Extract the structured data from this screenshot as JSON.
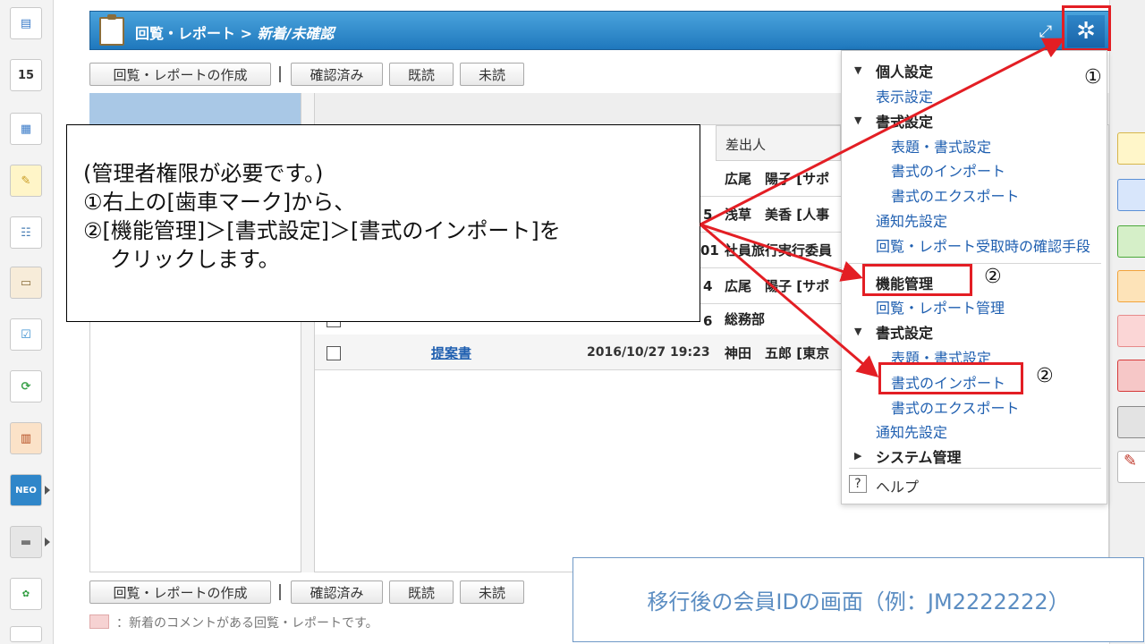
{
  "header": {
    "title": "回覧・レポート >",
    "subtitle": "新着/未確認"
  },
  "toolbar_top": {
    "create": "回覧・レポートの作成",
    "confirmed": "確認済み",
    "read": "既読",
    "unread": "未読"
  },
  "toolbar_bottom": {
    "create": "回覧・レポートの作成",
    "confirmed": "確認済み",
    "read": "既読",
    "unread": "未読"
  },
  "list": {
    "column_sender": "差出人",
    "rows": [
      {
        "time_suffix": "",
        "sender": "広尾　陽子 [サポ"
      },
      {
        "time_suffix": "5",
        "sender": "浅草　美香 [人事"
      },
      {
        "time_suffix": "01",
        "sender": "社員旅行実行委員"
      },
      {
        "time_suffix": "4",
        "sender": "広尾　陽子 [サポ"
      },
      {
        "time_suffix": "6",
        "sender": "総務部"
      },
      {
        "time_suffix": "",
        "title": "提案書",
        "date": "2016/10/27 19:23",
        "sender": "神田　五郎 [東京"
      }
    ]
  },
  "callout": {
    "line1": "(管理者権限が必要です。)",
    "line2": "①右上の[歯車マーク]から、",
    "line3": "②[機能管理]＞[書式設定]＞[書式のインポート]を",
    "line4": "クリックします。"
  },
  "dropdown": {
    "personal_settings": "個人設定",
    "display_settings": "表示設定",
    "format_settings_personal": "書式設定",
    "title_format_settings_1": "表題・書式設定",
    "format_import_1": "書式のインポート",
    "format_export_1": "書式のエクスポート",
    "notification_settings_1": "通知先設定",
    "confirm_method": "回覧・レポート受取時の確認手段",
    "function_management": "機能管理",
    "report_management": "回覧・レポート管理",
    "format_settings_admin": "書式設定",
    "title_format_settings_2": "表題・書式設定",
    "format_import_2": "書式のインポート",
    "format_export_2": "書式のエクスポート",
    "notification_settings_2": "通知先設定",
    "system_management": "システム管理",
    "help_icon": "?",
    "help": "ヘルプ"
  },
  "labels": {
    "step1": "①",
    "step2a": "②",
    "step2b": "②"
  },
  "calendar_day": "15",
  "legend": "：新着のコメントがある回覧・レポートです。",
  "member_note": "移行後の会員IDの画面（例：JM2222222）",
  "colors": {
    "header_blue": "#1f78bd",
    "highlight_red": "#e31e24",
    "link_blue": "#1f5fb0"
  }
}
